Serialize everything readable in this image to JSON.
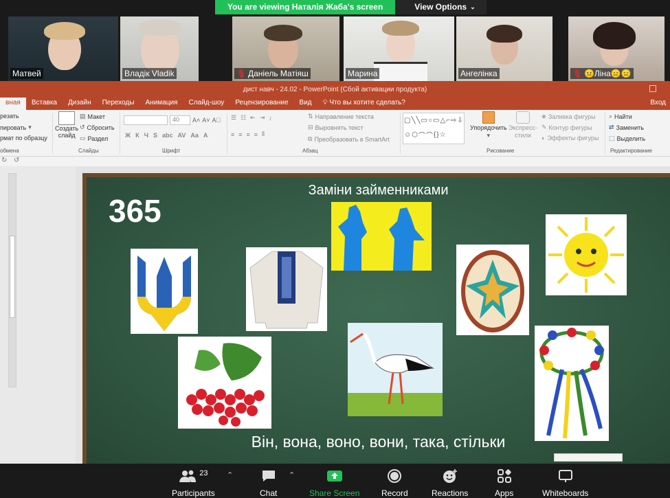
{
  "banner": {
    "viewing_text": "You are viewing Наталія Жаба's screen",
    "view_options_label": "View Options"
  },
  "participants_strip": [
    {
      "name": "Матвей",
      "muted": false
    },
    {
      "name": "Владік Vladik",
      "muted": false
    },
    {
      "name": "Даніель Матіяш",
      "muted": true
    },
    {
      "name": "Марина",
      "muted": false
    },
    {
      "name": "Ангелінка",
      "muted": false
    },
    {
      "name": "😐Ліна😑😑",
      "muted": true
    }
  ],
  "ppt": {
    "window_title": "дист навч - 24.02 - PowerPoint (Сбой активации продукта)",
    "tabs": [
      "вная",
      "Вставка",
      "Дизайн",
      "Переходы",
      "Анимация",
      "Слайд-шоу",
      "Рецензирование",
      "Вид"
    ],
    "tell_me": "Что вы хотите сделать?",
    "signin": "Вход",
    "ribbon": {
      "clipboard": {
        "cut": "резать",
        "copy": "пировать",
        "format_painter": "рмат по образцу",
        "label": "обмена"
      },
      "slides": {
        "new_slide_1": "Создать",
        "new_slide_2": "слайд",
        "layout": "Макет",
        "reset": "Сбросить",
        "section": "Раздел",
        "label": "Слайды"
      },
      "font": {
        "size": "40",
        "bold": "Ж",
        "italic": "К",
        "underline": "Ч",
        "strike": "S",
        "label": "Шрифт"
      },
      "paragraph": {
        "direction": "Направление текста",
        "align": "Выровнять текст",
        "smartart": "Преобразовать в SmartArt",
        "label": "Абзац"
      },
      "drawing": {
        "arrange_1": "Упорядочить",
        "quick_styles_1": "Экспресс-",
        "quick_styles_2": "стили",
        "fill": "Заливка фигуры",
        "outline": "Контур фигуры",
        "effects": "Эффекты фигуры",
        "label": "Рисование"
      },
      "editing": {
        "find": "Найти",
        "replace": "Заменить",
        "select": "Выделить",
        "label": "Редактирование"
      }
    }
  },
  "slide": {
    "number": "365",
    "title": "Заміни займенниками",
    "caption": "Він, вона, воно, вони, така, стільки"
  },
  "toolbar": {
    "participants_label": "Participants",
    "participants_count": "23",
    "chat_label": "Chat",
    "share_label": "Share Screen",
    "record_label": "Record",
    "reactions_label": "Reactions",
    "apps_label": "Apps",
    "whiteboards_label": "Whiteboards"
  },
  "colors": {
    "ppt_accent": "#b7472a",
    "zoom_green": "#23c05a",
    "muted_red": "#e02828"
  }
}
